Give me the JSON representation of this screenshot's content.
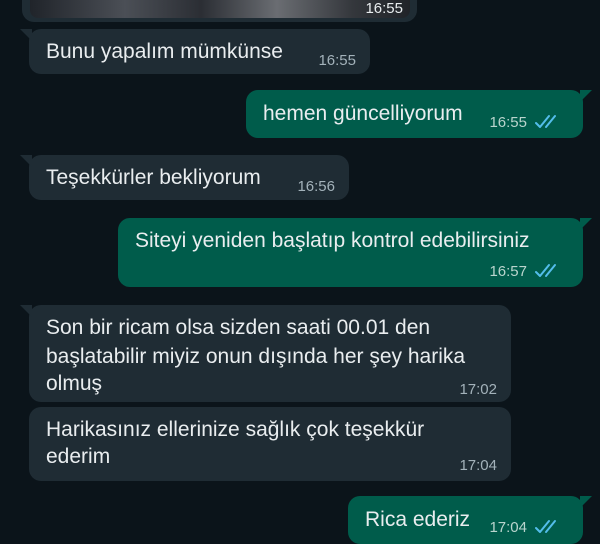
{
  "media": {
    "time": "16:55"
  },
  "messages": [
    {
      "direction": "in",
      "lines": [
        "Bunu yapalım mümkünse"
      ],
      "time": "16:55"
    },
    {
      "direction": "out",
      "lines": [
        "hemen güncelliyorum"
      ],
      "time": "16:55",
      "status": "read"
    },
    {
      "direction": "in",
      "lines": [
        "Teşekkürler bekliyorum"
      ],
      "time": "16:56"
    },
    {
      "direction": "out",
      "lines": [
        "Siteyi yeniden başlatıp kontrol edebilirsiniz"
      ],
      "time": "16:57",
      "status": "read"
    },
    {
      "direction": "in",
      "lines": [
        "Son bir ricam olsa sizden saati 00.01 den",
        "başlatabilir miyiz onun dışında her şey harika",
        "olmuş"
      ],
      "time": "17:02"
    },
    {
      "direction": "in",
      "lines": [
        "Harikasınız ellerinize sağlık çok teşekkür",
        "ederim"
      ],
      "time": "17:04"
    },
    {
      "direction": "out",
      "lines": [
        "Rica ederiz"
      ],
      "time": "17:04",
      "status": "read"
    }
  ],
  "icons": {
    "read_receipt": "double-check-icon"
  },
  "colors": {
    "background": "#0b141a",
    "incoming_bubble": "#1f2c34",
    "outgoing_bubble": "#005c4b",
    "read_tick": "#53bdeb"
  }
}
